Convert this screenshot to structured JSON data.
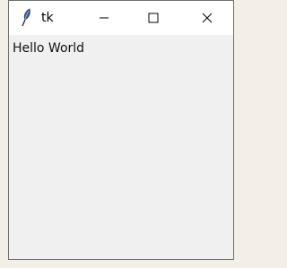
{
  "window": {
    "title": "tk",
    "icon": "feather-icon",
    "controls": [
      "minimize-icon",
      "maximize-icon",
      "close-icon"
    ]
  },
  "content": {
    "label_text": "Hello World"
  }
}
